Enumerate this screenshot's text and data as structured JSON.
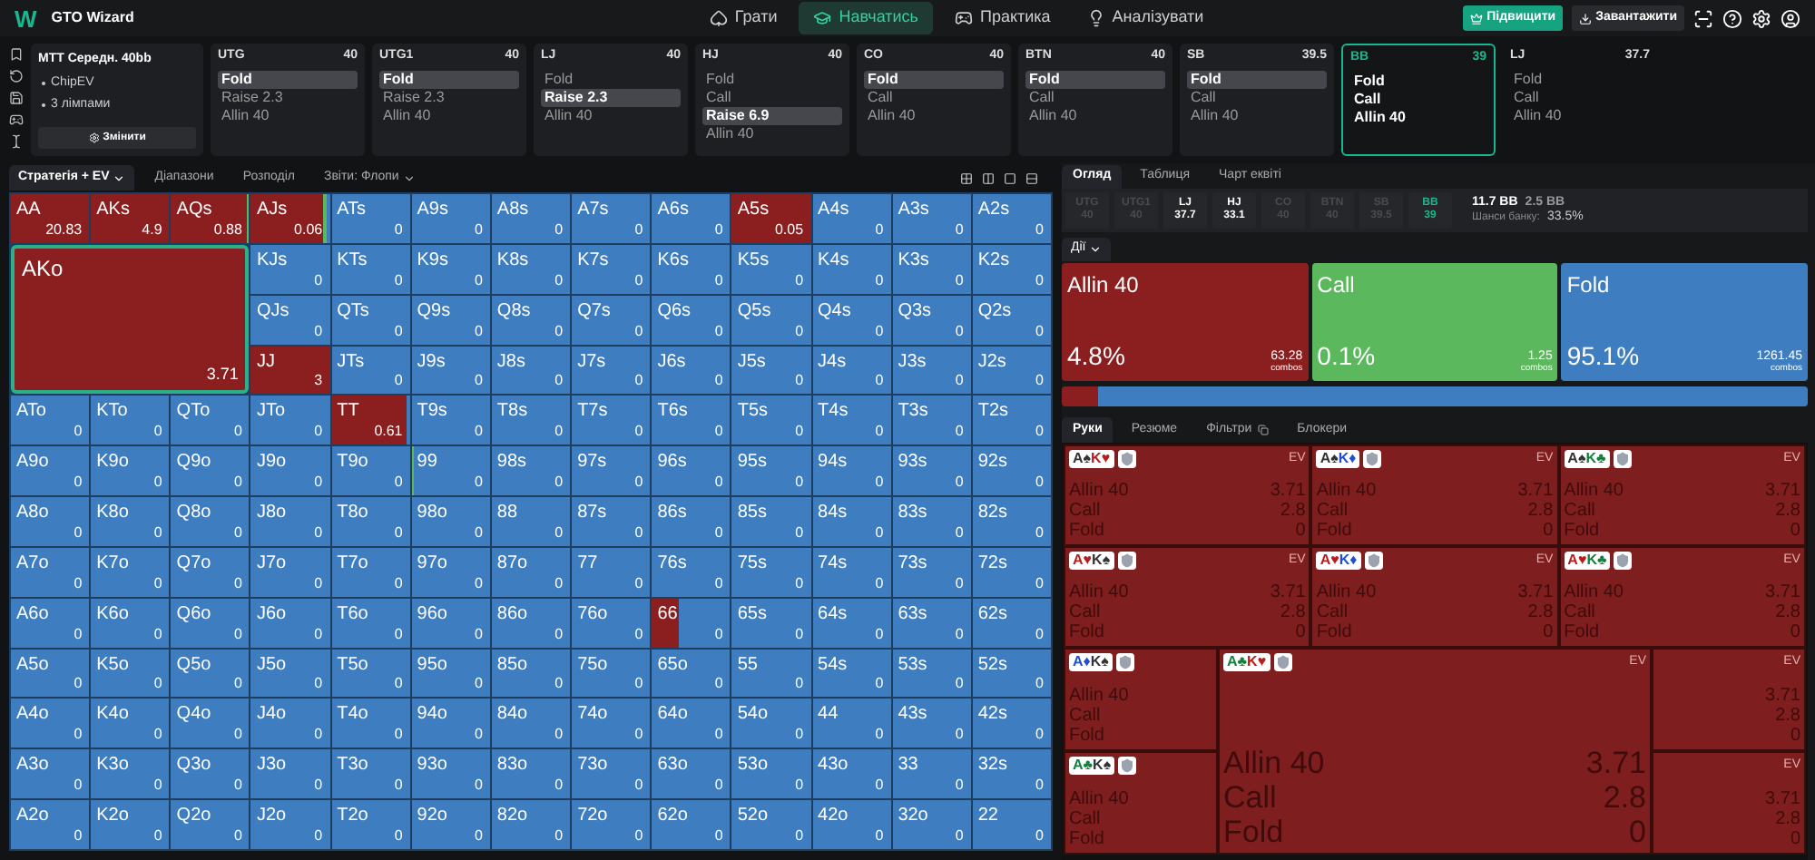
{
  "app": {
    "logo": "W",
    "title": "GTO Wizard"
  },
  "nav": [
    {
      "label": "Грати",
      "selected": false
    },
    {
      "label": "Навчатись",
      "selected": true
    },
    {
      "label": "Практика",
      "selected": false
    },
    {
      "label": "Аналізувати",
      "selected": false
    }
  ],
  "header_buttons": [
    {
      "label": "Підвищити",
      "kind": "upgrade"
    },
    {
      "label": "Завантажити",
      "kind": "plain"
    }
  ],
  "info": {
    "title": "MTT Середн. 40bb",
    "items": [
      "ChipEV",
      "3 лімпами"
    ],
    "button": "Змінити"
  },
  "positions": [
    {
      "name": "UTG",
      "stack": "40",
      "current": false,
      "upcoming": false,
      "actions": [
        {
          "label": "Fold",
          "selected": true
        },
        {
          "label": "Raise 2.3",
          "selected": false
        },
        {
          "label": "Allin 40",
          "selected": false
        }
      ]
    },
    {
      "name": "UTG1",
      "stack": "40",
      "current": false,
      "upcoming": false,
      "actions": [
        {
          "label": "Fold",
          "selected": true
        },
        {
          "label": "Raise 2.3",
          "selected": false
        },
        {
          "label": "Allin 40",
          "selected": false
        }
      ]
    },
    {
      "name": "LJ",
      "stack": "40",
      "current": false,
      "upcoming": false,
      "actions": [
        {
          "label": "Fold",
          "selected": false
        },
        {
          "label": "Raise 2.3",
          "selected": true
        },
        {
          "label": "Allin 40",
          "selected": false
        }
      ]
    },
    {
      "name": "HJ",
      "stack": "40",
      "current": false,
      "upcoming": false,
      "actions": [
        {
          "label": "Fold",
          "selected": false
        },
        {
          "label": "Call",
          "selected": false
        },
        {
          "label": "Raise 6.9",
          "selected": true
        },
        {
          "label": "Allin 40",
          "selected": false
        }
      ]
    },
    {
      "name": "CO",
      "stack": "40",
      "current": false,
      "upcoming": false,
      "actions": [
        {
          "label": "Fold",
          "selected": true
        },
        {
          "label": "Call",
          "selected": false
        },
        {
          "label": "Allin 40",
          "selected": false
        }
      ]
    },
    {
      "name": "BTN",
      "stack": "40",
      "current": false,
      "upcoming": false,
      "actions": [
        {
          "label": "Fold",
          "selected": true
        },
        {
          "label": "Call",
          "selected": false
        },
        {
          "label": "Allin 40",
          "selected": false
        }
      ]
    },
    {
      "name": "SB",
      "stack": "39.5",
      "current": false,
      "upcoming": false,
      "actions": [
        {
          "label": "Fold",
          "selected": true
        },
        {
          "label": "Call",
          "selected": false
        },
        {
          "label": "Allin 40",
          "selected": false
        }
      ]
    },
    {
      "name": "BB",
      "stack": "39",
      "current": true,
      "upcoming": false,
      "actions": [
        {
          "label": "Fold",
          "selected": false
        },
        {
          "label": "Call",
          "selected": false
        },
        {
          "label": "Allin 40",
          "selected": false
        }
      ]
    },
    {
      "name": "LJ",
      "stack": "37.7",
      "current": false,
      "upcoming": true,
      "actions": [
        {
          "label": "Fold",
          "selected": false
        },
        {
          "label": "Call",
          "selected": false
        },
        {
          "label": "Allin 40",
          "selected": false
        }
      ]
    }
  ],
  "view_tabs": [
    {
      "label": "Стратегія + EV",
      "dropdown": true,
      "selected": true
    },
    {
      "label": "Діапазони",
      "dropdown": false,
      "selected": false
    },
    {
      "label": "Розподіл",
      "dropdown": false,
      "selected": false
    },
    {
      "label": "Звіти: Флопи",
      "dropdown": true,
      "selected": false
    }
  ],
  "matrix": {
    "focus": {
      "hand": "AKo",
      "ev": "3.71",
      "mix": [
        {
          "kind": "allin",
          "level": 1
        }
      ]
    },
    "cells": [
      {
        "hand": "AA",
        "ev": "20.83",
        "mix": [
          {
            "kind": "allin",
            "level": 1
          }
        ]
      },
      {
        "hand": "AKs",
        "ev": "4.9",
        "mix": [
          {
            "kind": "allin",
            "level": 1
          }
        ]
      },
      {
        "hand": "AQs",
        "ev": "0.88",
        "mix": [
          {
            "kind": "allin",
            "level": 0.97
          },
          {
            "kind": "call",
            "level": 0.03
          }
        ]
      },
      {
        "hand": "AJs",
        "ev": "0.06",
        "mix": [
          {
            "kind": "allin",
            "level": 0.92
          },
          {
            "kind": "call",
            "level": 0.04
          }
        ]
      },
      {
        "hand": "ATs",
        "ev": "0"
      },
      {
        "hand": "A9s",
        "ev": "0"
      },
      {
        "hand": "A8s",
        "ev": "0"
      },
      {
        "hand": "A7s",
        "ev": "0"
      },
      {
        "hand": "A6s",
        "ev": "0"
      },
      {
        "hand": "A5s",
        "ev": "0.05",
        "mix": [
          {
            "kind": "allin",
            "level": 1
          }
        ]
      },
      {
        "hand": "A4s",
        "ev": "0"
      },
      {
        "hand": "A3s",
        "ev": "0"
      },
      {
        "hand": "A2s",
        "ev": "0"
      },
      {
        "hand": "KJs",
        "ev": "0"
      },
      {
        "hand": "KTs",
        "ev": "0"
      },
      {
        "hand": "K9s",
        "ev": "0"
      },
      {
        "hand": "K8s",
        "ev": "0"
      },
      {
        "hand": "K7s",
        "ev": "0"
      },
      {
        "hand": "K6s",
        "ev": "0"
      },
      {
        "hand": "K5s",
        "ev": "0"
      },
      {
        "hand": "K4s",
        "ev": "0"
      },
      {
        "hand": "K3s",
        "ev": "0"
      },
      {
        "hand": "K2s",
        "ev": "0"
      },
      {
        "hand": "QJs",
        "ev": "0"
      },
      {
        "hand": "QTs",
        "ev": "0"
      },
      {
        "hand": "Q9s",
        "ev": "0"
      },
      {
        "hand": "Q8s",
        "ev": "0"
      },
      {
        "hand": "Q7s",
        "ev": "0"
      },
      {
        "hand": "Q6s",
        "ev": "0"
      },
      {
        "hand": "Q5s",
        "ev": "0"
      },
      {
        "hand": "Q4s",
        "ev": "0"
      },
      {
        "hand": "Q3s",
        "ev": "0"
      },
      {
        "hand": "Q2s",
        "ev": "0"
      },
      {
        "hand": "JJ",
        "ev": "3",
        "mix": [
          {
            "kind": "allin",
            "level": 1
          }
        ]
      },
      {
        "hand": "JTs",
        "ev": "0"
      },
      {
        "hand": "J9s",
        "ev": "0"
      },
      {
        "hand": "J8s",
        "ev": "0"
      },
      {
        "hand": "J7s",
        "ev": "0"
      },
      {
        "hand": "J6s",
        "ev": "0"
      },
      {
        "hand": "J5s",
        "ev": "0"
      },
      {
        "hand": "J4s",
        "ev": "0"
      },
      {
        "hand": "J3s",
        "ev": "0"
      },
      {
        "hand": "J2s",
        "ev": "0"
      },
      {
        "hand": "ATo",
        "ev": "0"
      },
      {
        "hand": "KTo",
        "ev": "0"
      },
      {
        "hand": "QTo",
        "ev": "0"
      },
      {
        "hand": "JTo",
        "ev": "0"
      },
      {
        "hand": "TT",
        "ev": "0.61",
        "mix": [
          {
            "kind": "allin",
            "level": 0.96
          }
        ]
      },
      {
        "hand": "T9s",
        "ev": "0"
      },
      {
        "hand": "T8s",
        "ev": "0"
      },
      {
        "hand": "T7s",
        "ev": "0"
      },
      {
        "hand": "T6s",
        "ev": "0"
      },
      {
        "hand": "T5s",
        "ev": "0"
      },
      {
        "hand": "T4s",
        "ev": "0"
      },
      {
        "hand": "T3s",
        "ev": "0"
      },
      {
        "hand": "T2s",
        "ev": "0"
      },
      {
        "hand": "A9o",
        "ev": "0"
      },
      {
        "hand": "K9o",
        "ev": "0"
      },
      {
        "hand": "Q9o",
        "ev": "0"
      },
      {
        "hand": "J9o",
        "ev": "0"
      },
      {
        "hand": "T9o",
        "ev": "0"
      },
      {
        "hand": "99",
        "ev": "0",
        "mix": [
          {
            "kind": "call",
            "level": 0.03
          }
        ]
      },
      {
        "hand": "98s",
        "ev": "0"
      },
      {
        "hand": "97s",
        "ev": "0"
      },
      {
        "hand": "96s",
        "ev": "0"
      },
      {
        "hand": "95s",
        "ev": "0"
      },
      {
        "hand": "94s",
        "ev": "0"
      },
      {
        "hand": "93s",
        "ev": "0"
      },
      {
        "hand": "92s",
        "ev": "0"
      },
      {
        "hand": "A8o",
        "ev": "0"
      },
      {
        "hand": "K8o",
        "ev": "0"
      },
      {
        "hand": "Q8o",
        "ev": "0"
      },
      {
        "hand": "J8o",
        "ev": "0"
      },
      {
        "hand": "T8o",
        "ev": "0"
      },
      {
        "hand": "98o",
        "ev": "0"
      },
      {
        "hand": "88",
        "ev": "0"
      },
      {
        "hand": "87s",
        "ev": "0"
      },
      {
        "hand": "86s",
        "ev": "0"
      },
      {
        "hand": "85s",
        "ev": "0"
      },
      {
        "hand": "84s",
        "ev": "0"
      },
      {
        "hand": "83s",
        "ev": "0"
      },
      {
        "hand": "82s",
        "ev": "0"
      },
      {
        "hand": "A7o",
        "ev": "0"
      },
      {
        "hand": "K7o",
        "ev": "0"
      },
      {
        "hand": "Q7o",
        "ev": "0"
      },
      {
        "hand": "J7o",
        "ev": "0"
      },
      {
        "hand": "T7o",
        "ev": "0"
      },
      {
        "hand": "97o",
        "ev": "0"
      },
      {
        "hand": "87o",
        "ev": "0"
      },
      {
        "hand": "77",
        "ev": "0"
      },
      {
        "hand": "76s",
        "ev": "0"
      },
      {
        "hand": "75s",
        "ev": "0"
      },
      {
        "hand": "74s",
        "ev": "0"
      },
      {
        "hand": "73s",
        "ev": "0"
      },
      {
        "hand": "72s",
        "ev": "0"
      },
      {
        "hand": "A6o",
        "ev": "0"
      },
      {
        "hand": "K6o",
        "ev": "0"
      },
      {
        "hand": "Q6o",
        "ev": "0"
      },
      {
        "hand": "J6o",
        "ev": "0"
      },
      {
        "hand": "T6o",
        "ev": "0"
      },
      {
        "hand": "96o",
        "ev": "0"
      },
      {
        "hand": "86o",
        "ev": "0"
      },
      {
        "hand": "76o",
        "ev": "0"
      },
      {
        "hand": "66",
        "ev": "0",
        "mix": [
          {
            "kind": "allin",
            "level": 0.35
          }
        ]
      },
      {
        "hand": "65s",
        "ev": "0"
      },
      {
        "hand": "64s",
        "ev": "0"
      },
      {
        "hand": "63s",
        "ev": "0"
      },
      {
        "hand": "62s",
        "ev": "0"
      },
      {
        "hand": "A5o",
        "ev": "0"
      },
      {
        "hand": "K5o",
        "ev": "0"
      },
      {
        "hand": "Q5o",
        "ev": "0"
      },
      {
        "hand": "J5o",
        "ev": "0"
      },
      {
        "hand": "T5o",
        "ev": "0"
      },
      {
        "hand": "95o",
        "ev": "0"
      },
      {
        "hand": "85o",
        "ev": "0"
      },
      {
        "hand": "75o",
        "ev": "0"
      },
      {
        "hand": "65o",
        "ev": "0"
      },
      {
        "hand": "55",
        "ev": "0"
      },
      {
        "hand": "54s",
        "ev": "0"
      },
      {
        "hand": "53s",
        "ev": "0"
      },
      {
        "hand": "52s",
        "ev": "0"
      },
      {
        "hand": "A4o",
        "ev": "0"
      },
      {
        "hand": "K4o",
        "ev": "0"
      },
      {
        "hand": "Q4o",
        "ev": "0"
      },
      {
        "hand": "J4o",
        "ev": "0"
      },
      {
        "hand": "T4o",
        "ev": "0"
      },
      {
        "hand": "94o",
        "ev": "0"
      },
      {
        "hand": "84o",
        "ev": "0"
      },
      {
        "hand": "74o",
        "ev": "0"
      },
      {
        "hand": "64o",
        "ev": "0"
      },
      {
        "hand": "54o",
        "ev": "0"
      },
      {
        "hand": "44",
        "ev": "0"
      },
      {
        "hand": "43s",
        "ev": "0"
      },
      {
        "hand": "42s",
        "ev": "0"
      },
      {
        "hand": "A3o",
        "ev": "0"
      },
      {
        "hand": "K3o",
        "ev": "0"
      },
      {
        "hand": "Q3o",
        "ev": "0"
      },
      {
        "hand": "J3o",
        "ev": "0"
      },
      {
        "hand": "T3o",
        "ev": "0"
      },
      {
        "hand": "93o",
        "ev": "0"
      },
      {
        "hand": "83o",
        "ev": "0"
      },
      {
        "hand": "73o",
        "ev": "0"
      },
      {
        "hand": "63o",
        "ev": "0"
      },
      {
        "hand": "53o",
        "ev": "0"
      },
      {
        "hand": "43o",
        "ev": "0"
      },
      {
        "hand": "33",
        "ev": "0"
      },
      {
        "hand": "32s",
        "ev": "0"
      },
      {
        "hand": "A2o",
        "ev": "0"
      },
      {
        "hand": "K2o",
        "ev": "0"
      },
      {
        "hand": "Q2o",
        "ev": "0"
      },
      {
        "hand": "J2o",
        "ev": "0"
      },
      {
        "hand": "T2o",
        "ev": "0"
      },
      {
        "hand": "92o",
        "ev": "0"
      },
      {
        "hand": "82o",
        "ev": "0"
      },
      {
        "hand": "72o",
        "ev": "0"
      },
      {
        "hand": "62o",
        "ev": "0"
      },
      {
        "hand": "52o",
        "ev": "0"
      },
      {
        "hand": "42o",
        "ev": "0"
      },
      {
        "hand": "32o",
        "ev": "0"
      },
      {
        "hand": "22",
        "ev": "0"
      }
    ]
  },
  "panel_tabs": [
    {
      "label": "Огляд",
      "selected": true
    },
    {
      "label": "Таблиця",
      "selected": false
    },
    {
      "label": "Чарт еквіті",
      "selected": false
    }
  ],
  "stacks": [
    {
      "name": "UTG",
      "stack": "40",
      "folded": true,
      "current": false
    },
    {
      "name": "UTG1",
      "stack": "40",
      "folded": true,
      "current": false
    },
    {
      "name": "LJ",
      "stack": "37.7",
      "folded": false,
      "current": false
    },
    {
      "name": "HJ",
      "stack": "33.1",
      "folded": false,
      "current": false
    },
    {
      "name": "CO",
      "stack": "40",
      "folded": true,
      "current": false
    },
    {
      "name": "BTN",
      "stack": "40",
      "folded": true,
      "current": false
    },
    {
      "name": "SB",
      "stack": "39.5",
      "folded": true,
      "current": false
    },
    {
      "name": "BB",
      "stack": "39",
      "folded": false,
      "current": true
    }
  ],
  "pot": {
    "total": "11.7 BB",
    "to_call": "2.5 BB",
    "odds_label": "Шанси банку:",
    "odds": "33.5%"
  },
  "actions_menu": "Дії",
  "summary": [
    {
      "kind": "allin",
      "label": "Allin 40",
      "percent": "4.8%",
      "combos": "63.28",
      "unit": "combos"
    },
    {
      "kind": "call",
      "label": "Call",
      "percent": "0.1%",
      "combos": "1.25",
      "unit": "combos"
    },
    {
      "kind": "fold",
      "label": "Fold",
      "percent": "95.1%",
      "combos": "1261.45",
      "unit": "combos"
    }
  ],
  "frequency_bar": [
    {
      "kind": "allin",
      "level": 0.048
    },
    {
      "kind": "call",
      "level": 0.001
    },
    {
      "kind": "fold",
      "level": 0.951
    }
  ],
  "hand_tabs": [
    {
      "label": "Руки",
      "selected": true,
      "icon": false
    },
    {
      "label": "Резюме",
      "selected": false,
      "icon": false
    },
    {
      "label": "Фільтри",
      "selected": false,
      "icon": true
    },
    {
      "label": "Блокери",
      "selected": false,
      "icon": false
    }
  ],
  "combos": [
    {
      "kind": "full",
      "cards": [
        {
          "rank": "A",
          "suit": "♠",
          "color": "#333333"
        },
        {
          "rank": "K",
          "suit": "♥",
          "color": "#b91c1c"
        }
      ],
      "ev_label": "EV",
      "rows": [
        {
          "label": "Allin 40",
          "ev": "3.71"
        },
        {
          "label": "Call",
          "ev": "2.8"
        },
        {
          "label": "Fold",
          "ev": "0"
        }
      ]
    },
    {
      "kind": "full",
      "cards": [
        {
          "rank": "A",
          "suit": "♠",
          "color": "#333333"
        },
        {
          "rank": "K",
          "suit": "♦",
          "color": "#1d4ed8"
        }
      ],
      "ev_label": "EV",
      "rows": [
        {
          "label": "Allin 40",
          "ev": "3.71"
        },
        {
          "label": "Call",
          "ev": "2.8"
        },
        {
          "label": "Fold",
          "ev": "0"
        }
      ]
    },
    {
      "kind": "full",
      "cards": [
        {
          "rank": "A",
          "suit": "♠",
          "color": "#333333"
        },
        {
          "rank": "K",
          "suit": "♣",
          "color": "#15803d"
        }
      ],
      "ev_label": "EV",
      "rows": [
        {
          "label": "Allin 40",
          "ev": "3.71"
        },
        {
          "label": "Call",
          "ev": "2.8"
        },
        {
          "label": "Fold",
          "ev": "0"
        }
      ]
    },
    {
      "kind": "full",
      "cards": [
        {
          "rank": "A",
          "suit": "♥",
          "color": "#b91c1c"
        },
        {
          "rank": "K",
          "suit": "♠",
          "color": "#333333"
        }
      ],
      "ev_label": "EV",
      "rows": [
        {
          "label": "Allin 40",
          "ev": "3.71"
        },
        {
          "label": "Call",
          "ev": "2.8"
        },
        {
          "label": "Fold",
          "ev": "0"
        }
      ]
    },
    {
      "kind": "full",
      "cards": [
        {
          "rank": "A",
          "suit": "♥",
          "color": "#b91c1c"
        },
        {
          "rank": "K",
          "suit": "♦",
          "color": "#1d4ed8"
        }
      ],
      "ev_label": "EV",
      "rows": [
        {
          "label": "Allin 40",
          "ev": "3.71"
        },
        {
          "label": "Call",
          "ev": "2.8"
        },
        {
          "label": "Fold",
          "ev": "0"
        }
      ]
    },
    {
      "kind": "full",
      "cards": [
        {
          "rank": "A",
          "suit": "♥",
          "color": "#b91c1c"
        },
        {
          "rank": "K",
          "suit": "♣",
          "color": "#15803d"
        }
      ],
      "ev_label": "EV",
      "rows": [
        {
          "label": "Allin 40",
          "ev": "3.71"
        },
        {
          "label": "Call",
          "ev": "2.8"
        },
        {
          "label": "Fold",
          "ev": "0"
        }
      ]
    },
    {
      "kind": "narrow",
      "cards": [
        {
          "rank": "A",
          "suit": "♦",
          "color": "#1d4ed8"
        },
        {
          "rank": "K",
          "suit": "♠",
          "color": "#333333"
        }
      ],
      "rows": [
        {
          "label": "Allin 40"
        },
        {
          "label": "Call"
        },
        {
          "label": "Fold"
        }
      ]
    },
    {
      "kind": "narrow",
      "cards": [
        {
          "rank": "A",
          "suit": "♣",
          "color": "#15803d"
        },
        {
          "rank": "K",
          "suit": "♠",
          "color": "#333333"
        }
      ],
      "rows": [
        {
          "label": "Allin 40"
        },
        {
          "label": "Call"
        },
        {
          "label": "Fold"
        }
      ]
    },
    {
      "kind": "big",
      "cards": [
        {
          "rank": "A",
          "suit": "♣",
          "color": "#15803d"
        },
        {
          "rank": "K",
          "suit": "♥",
          "color": "#b91c1c"
        }
      ],
      "ev_label": "EV",
      "rows": [
        {
          "label": "Allin 40",
          "ev": "3.71"
        },
        {
          "label": "Call",
          "ev": "2.8"
        },
        {
          "label": "Fold",
          "ev": "0"
        }
      ]
    },
    {
      "kind": "values",
      "ev_label": "EV",
      "rows": [
        {
          "ev": "3.71"
        },
        {
          "ev": "2.8"
        },
        {
          "ev": "0"
        }
      ]
    },
    {
      "kind": "values",
      "ev_label": "EV",
      "rows": [
        {
          "ev": "3.71"
        },
        {
          "ev": "2.8"
        },
        {
          "ev": "0"
        }
      ]
    }
  ]
}
